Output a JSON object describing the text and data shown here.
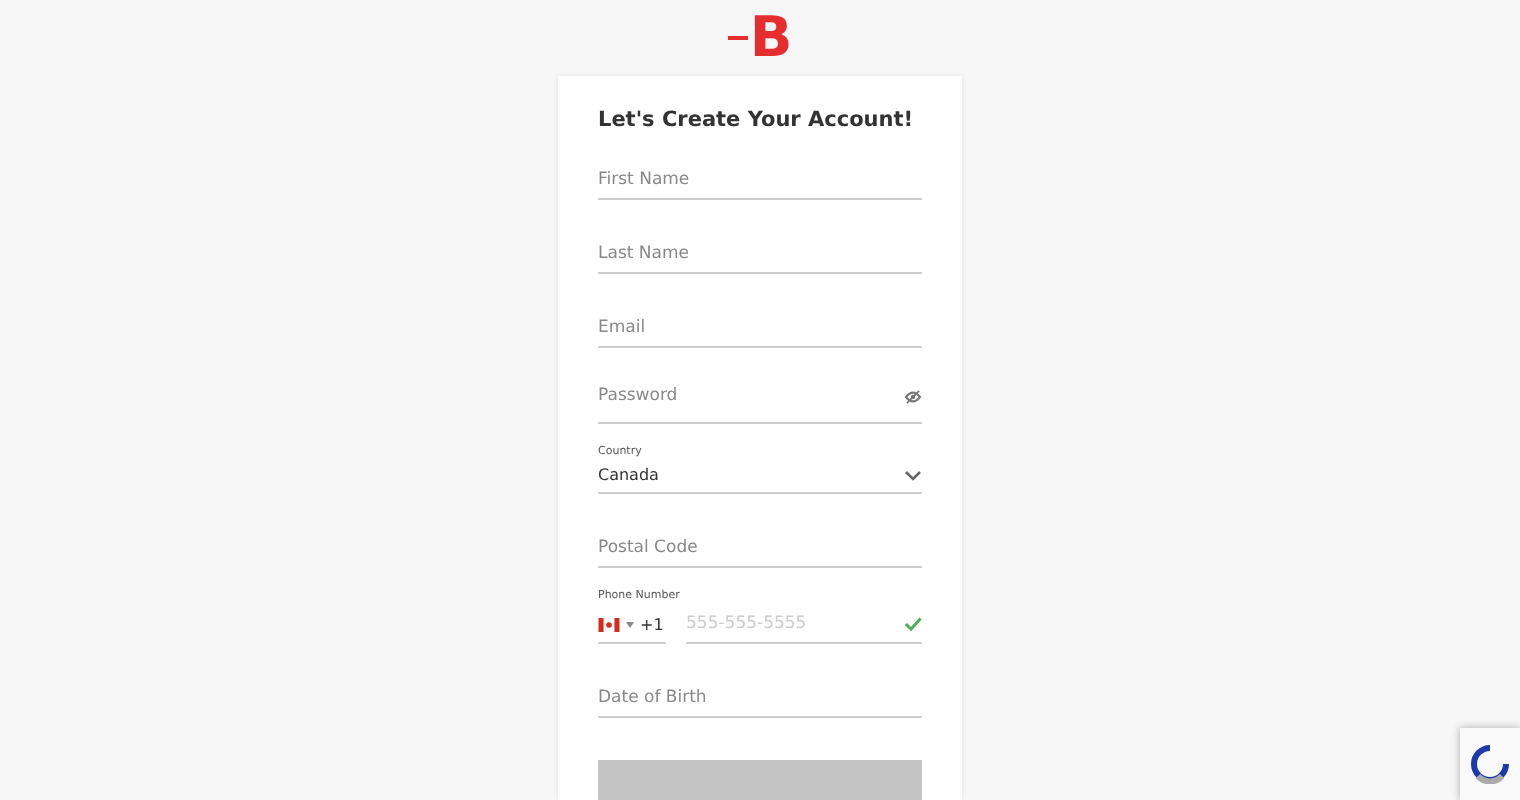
{
  "logo": {
    "text": "B"
  },
  "form": {
    "title": "Let's Create Your Account!",
    "fields": [
      {
        "kind": "text",
        "placeholder": "First Name"
      },
      {
        "kind": "text",
        "placeholder": "Last Name"
      },
      {
        "kind": "text",
        "placeholder": "Email"
      },
      {
        "kind": "password",
        "placeholder": "Password"
      },
      {
        "kind": "select",
        "label": "Country",
        "value": "Canada"
      },
      {
        "kind": "text",
        "placeholder": "Postal Code"
      },
      {
        "kind": "phone",
        "label": "Phone Number",
        "dial_code": "+1",
        "placeholder": "555-555-5555",
        "valid": true
      },
      {
        "kind": "text",
        "placeholder": "Date of Birth"
      }
    ],
    "submit": {
      "disabled": true
    }
  }
}
